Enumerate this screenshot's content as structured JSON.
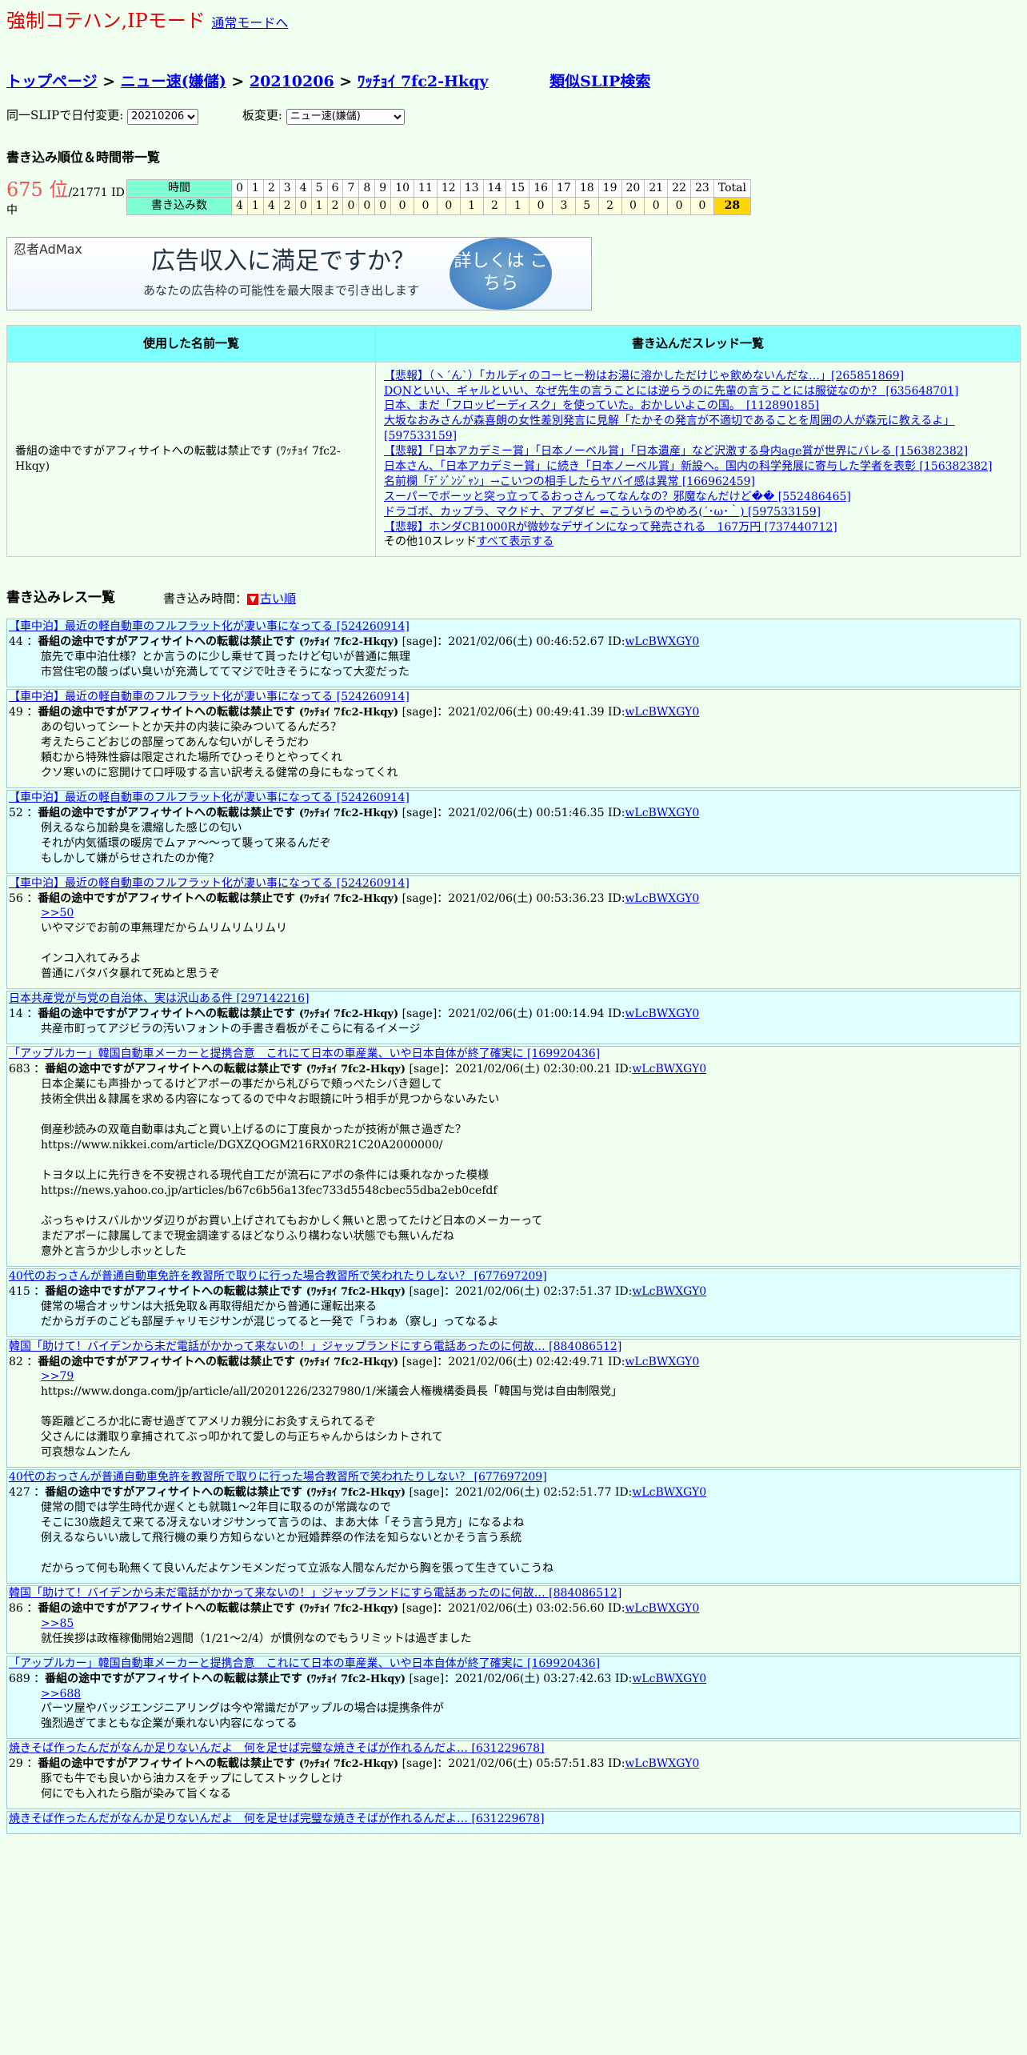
{
  "header": {
    "mode_title": "強制コテハン,IPモード",
    "normal_mode_link": "通常モードへ"
  },
  "breadcrumb": {
    "top": "トップページ",
    "board": "ニュー速(嫌儲)",
    "date": "20210206",
    "slip": "ﾜｯﾁｮｲ 7fc2-Hkqy",
    "similar": "類似SLIP検索"
  },
  "controls": {
    "date_label": "同一SLIPで日付変更:",
    "date_value": "20210206",
    "board_label": "板変更:",
    "board_value": "ニュー速(嫌儲)"
  },
  "ranking": {
    "section_title": "書き込み順位＆時間帯一覧",
    "rank": "675 位",
    "total": "/21771 ID中",
    "time_label": "時間",
    "count_label": "書き込み数",
    "total_label": "Total",
    "hours": [
      "0",
      "1",
      "2",
      "3",
      "4",
      "5",
      "6",
      "7",
      "8",
      "9",
      "10",
      "11",
      "12",
      "13",
      "14",
      "15",
      "16",
      "17",
      "18",
      "19",
      "20",
      "21",
      "22",
      "23"
    ],
    "counts": [
      "4",
      "1",
      "4",
      "2",
      "0",
      "1",
      "2",
      "0",
      "0",
      "0",
      "0",
      "0",
      "0",
      "1",
      "2",
      "1",
      "0",
      "3",
      "5",
      "2",
      "0",
      "0",
      "0",
      "0"
    ],
    "total_count": "28"
  },
  "ad": {
    "logo": "忍者AdMax",
    "headline": "広告収入に満足ですか？",
    "sub": "あなたの広告枠の可能性を最大限まで引き出します",
    "button": "詳しくは こちら"
  },
  "summary": {
    "names_header": "使用した名前一覧",
    "threads_header": "書き込んだスレッド一覧",
    "name": "番組の途中ですがアフィサイトへの転載は禁止です (ﾜｯﾁｮｲ 7fc2-Hkqy)",
    "threads": [
      "【悲報】（ヽ´ん`）「カルディのコーヒー粉はお湯に溶かしただけじゃ飲めないんだな…」[265851869]",
      "DQNといい、ギャルといい、なぜ先生の言うことには逆らうのに先輩の言うことには服従なのか？ [635648701]",
      "日本、まだ「フロッピーディスク」を使っていた。おかしいよこの国。　[112890185]",
      "大坂なおみさんが森喜朗の女性差別発言に見解「たかその発言が不適切であることを周囲の人が森元に教えるよ」[597533159]",
      "【悲報】「日本アカデミー賞」「日本ノーベル賞」「日本遺産」など沢激する身内age賞が世界にバレる [156382382]",
      "日本さん、「日本アカデミー賞」に続き「日本ノーベル賞」新設へ。国内の科学発展に寄与した学者を表彰 [156382382]",
      "名前欄「ﾃﾞｼﾞﾝｼﾞｬﾝ」→こいつの相手したらヤバイ感は異常 [166962459]",
      "スーパーでボーッと突っ立ってるおっさんってなんなの？邪魔なんだけど�� [552486465]",
      "ドラゴボ、カップラ、マクドナ、アプダビ ⇐こういうのやめろ(´･ω･｀) [597533159]",
      "【悲報】ホンダCB1000Rが微妙なデザインになって発売される　167万円 [737440712]"
    ],
    "others_text": "その他10スレッド",
    "others_link": "すべて表示する"
  },
  "responses": {
    "title": "書き込みレス一覧",
    "time_label": "書き込み時間：",
    "order_link": "古い順",
    "posts": [
      {
        "thread": "【車中泊】最近の軽自動車のフルフラット化が凄い事になってる [524260914]",
        "num": "44",
        "date": "2021/02/06(土) 00:46:52.67",
        "id": "wLcBWXGY0",
        "lines": [
          "旅先で車中泊仕様？とか言うのに少し乗せて貰ったけど匂いが普通に無理",
          "市営住宅の酸っぱい臭いが充満しててマジで吐きそうになって大変だった"
        ]
      },
      {
        "thread": "【車中泊】最近の軽自動車のフルフラット化が凄い事になってる [524260914]",
        "num": "49",
        "date": "2021/02/06(土) 00:49:41.39",
        "id": "wLcBWXGY0",
        "lines": [
          "あの匂いってシートとか天井の内装に染みついてるんだろ？",
          "考えたらこどおじの部屋ってあんな匂いがしそうだわ",
          "頼むから特殊性癖は限定された場所でひっそりとやってくれ",
          "クソ寒いのに窓開けて口呼吸する言い訳考える健常の身にもなってくれ"
        ]
      },
      {
        "thread": "【車中泊】最近の軽自動車のフルフラット化が凄い事になってる [524260914]",
        "num": "52",
        "date": "2021/02/06(土) 00:51:46.35",
        "id": "wLcBWXGY0",
        "lines": [
          "例えるなら加齢臭を濃縮した感じの匂い",
          "それが内気循環の暖房でムァァ～～って襲って来るんだぞ",
          "もしかして嫌がらせされたのか俺？"
        ]
      },
      {
        "thread": "【車中泊】最近の軽自動車のフルフラット化が凄い事になってる [524260914]",
        "num": "56",
        "date": "2021/02/06(土) 00:53:36.23",
        "id": "wLcBWXGY0",
        "anchor": ">>50",
        "lines": [
          "いやマジでお前の車無理だからムリムリムリムリ",
          "",
          "インコ入れてみろよ",
          "普通にバタバタ暴れて死ぬと思うぞ"
        ]
      },
      {
        "thread": "日本共産党が与党の自治体、実は沢山ある件 [297142216]",
        "num": "14",
        "date": "2021/02/06(土) 01:00:14.94",
        "id": "wLcBWXGY0",
        "lines": [
          "共産市町ってアジビラの汚いフォントの手書き看板がそこらに有るイメージ"
        ]
      },
      {
        "thread": "「アップルカー」韓国自動車メーカーと提携合意　これにて日本の車産業、いや日本自体が終了確実に [169920436]",
        "num": "683",
        "date": "2021/02/06(土) 02:30:00.21",
        "id": "wLcBWXGY0",
        "lines": [
          "日本企業にも声掛かってるけどアポーの事だから札びらで頬っぺたシバき廻して",
          "技術全供出＆隷属を求める内容になってるので中々お眼鏡に叶う相手が見つからないみたい",
          "",
          "倒産秒読みの双竜自動車は丸ごと買い上げるのに丁度良かったが技術が無さ過ぎた？",
          "https://www.nikkei.com/article/DGXZQOGM216RX0R21C20A2000000/",
          "",
          "トヨタ以上に先行きを不安視される現代自工だが流石にアポの条件には乗れなかった模様",
          "https://news.yahoo.co.jp/articles/b67c6b56a13fec733d5548cbec55dba2eb0cefdf",
          "",
          "ぶっちゃけスバルかツダ辺りがお買い上げされてもおかしく無いと思ってたけど日本のメーカーって",
          "まだアポーに隷属してまで現金調達するほどなりふり構わない状態でも無いんだね",
          "意外と言うか少しホッとした"
        ]
      },
      {
        "thread": "40代のおっさんが普通自動車免許を教習所で取りに行った場合教習所で笑われたりしない？ [677697209]",
        "num": "415",
        "date": "2021/02/06(土) 02:37:51.37",
        "id": "wLcBWXGY0",
        "lines": [
          "健常の場合オッサンは大抵免取＆再取得組だから普通に運転出来る",
          "だからガチのこども部屋チャリモジサンが混じってると一発で「うわぁ（察し」ってなるよ"
        ]
      },
      {
        "thread": "韓国「助けて！バイデンから未だ電話がかかって来ないの！」ジャップランドにすら電話あったのに何故… [884086512]",
        "num": "82",
        "date": "2021/02/06(土) 02:42:49.71",
        "id": "wLcBWXGY0",
        "anchor": ">>79",
        "lines": [
          "https://www.donga.com/jp/article/all/20201226/2327980/1/米議会人権機構委員長「韓国与党は自由制限党」",
          "",
          "等距離どころか北に寄せ過ぎてアメリカ親分にお灸すえられてるぞ",
          "父さんには灘取り拿捕されてぶっ叩かれて愛しの与正ちゃんからはシカトされて",
          "可哀想なムンたん"
        ]
      },
      {
        "thread": "40代のおっさんが普通自動車免許を教習所で取りに行った場合教習所で笑われたりしない？ [677697209]",
        "num": "427",
        "date": "2021/02/06(土) 02:52:51.77",
        "id": "wLcBWXGY0",
        "lines": [
          "健常の間では学生時代か遅くとも就職1～2年目に取るのが常識なので",
          "そこに30歳超えて来てる冴えないオジサンって言うのは、まあ大体「そう言う見方」になるよね",
          "例えるならいい歳して飛行機の乗り方知らないとか冠婚葬祭の作法を知らないとかそう言う系統",
          "",
          "だからって何も恥無くて良いんだよケンモメンだって立派な人間なんだから胸を張って生きていこうね"
        ]
      },
      {
        "thread": "韓国「助けて！バイデンから未だ電話がかかって来ないの！」ジャップランドにすら電話あったのに何故… [884086512]",
        "num": "86",
        "date": "2021/02/06(土) 03:02:56.60",
        "id": "wLcBWXGY0",
        "anchor": ">>85",
        "lines": [
          "就任挨拶は政権稼働開始2週間（1/21～2/4）が慣例なのでもうリミットは過ぎました"
        ]
      },
      {
        "thread": "「アップルカー」韓国自動車メーカーと提携合意　これにて日本の車産業、いや日本自体が終了確実に [169920436]",
        "num": "689",
        "date": "2021/02/06(土) 03:27:42.63",
        "id": "wLcBWXGY0",
        "anchor": ">>688",
        "lines": [
          "パーツ屋やバッジエンジニアリングは今や常識だがアップルの場合は提携条件が",
          "強烈過ぎてまともな企業が乗れない内容になってる"
        ]
      },
      {
        "thread": "焼きそば作ったんだがなんか足りないんだよ　何を足せば完璧な焼きそばが作れるんだよ… [631229678]",
        "num": "29",
        "date": "2021/02/06(土) 05:57:51.83",
        "id": "wLcBWXGY0",
        "lines": [
          "豚でも牛でも良いから油カスをチップにしてストックしとけ",
          "何にでも入れたら脂が染みて旨くなる"
        ]
      },
      {
        "thread": "焼きそば作ったんだがなんか足りないんだよ　何を足せば完璧な焼きそばが作れるんだよ… [631229678]",
        "num": "",
        "date": "",
        "id": "",
        "lines": []
      }
    ],
    "poster_name": "番組の途中ですがアフィサイトへの転載は禁止です",
    "poster_trip": "(ﾜｯﾁｮｲ 7fc2-Hkqy)",
    "sage": "[sage]"
  }
}
